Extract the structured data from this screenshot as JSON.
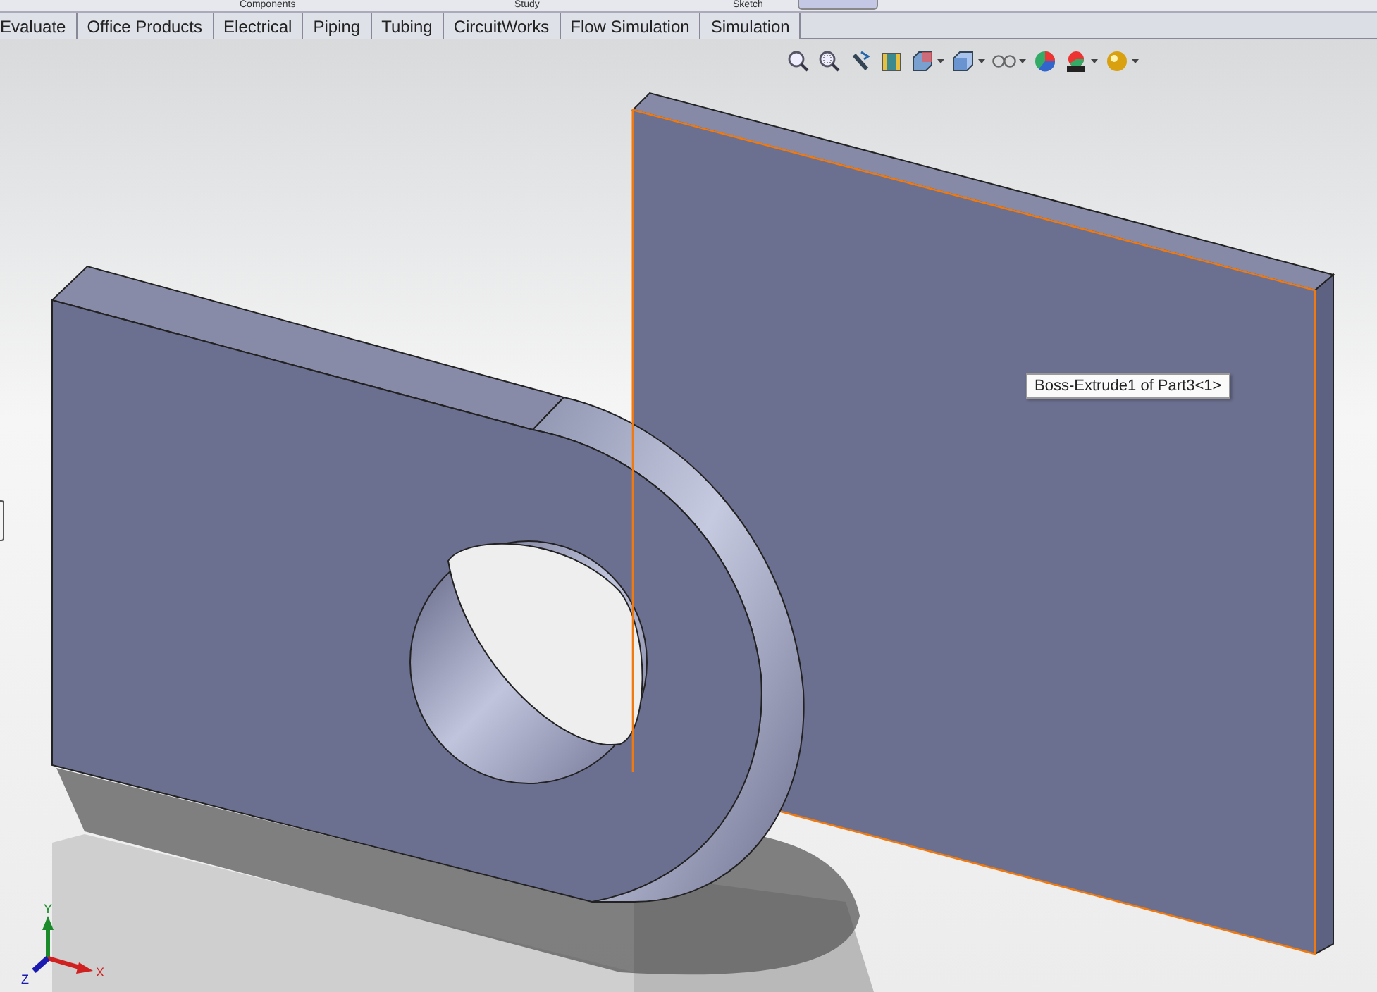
{
  "top_row": [
    "Components",
    "Study",
    "Sketch"
  ],
  "tabs": [
    {
      "label": "Evaluate",
      "selected": false
    },
    {
      "label": "Office Products",
      "selected": false
    },
    {
      "label": "Electrical",
      "selected": false
    },
    {
      "label": "Piping",
      "selected": false
    },
    {
      "label": "Tubing",
      "selected": false
    },
    {
      "label": "CircuitWorks",
      "selected": false
    },
    {
      "label": "Flow Simulation",
      "selected": false
    },
    {
      "label": "Simulation",
      "selected": false
    }
  ],
  "view_toolbar": [
    {
      "kind": "zoom",
      "dropdown": false
    },
    {
      "kind": "zoom-area",
      "dropdown": false
    },
    {
      "kind": "previous",
      "dropdown": false
    },
    {
      "kind": "section",
      "dropdown": false
    },
    {
      "kind": "orientation",
      "dropdown": true
    },
    {
      "kind": "display",
      "dropdown": true
    },
    {
      "kind": "hide",
      "dropdown": true
    },
    {
      "kind": "appearance",
      "dropdown": false
    },
    {
      "kind": "scene",
      "dropdown": true
    },
    {
      "kind": "lights",
      "dropdown": true
    }
  ],
  "tooltip": "Boss-Extrude1 of Part3<1>",
  "triad": {
    "x": "X",
    "y": "Y",
    "z": "Z"
  }
}
